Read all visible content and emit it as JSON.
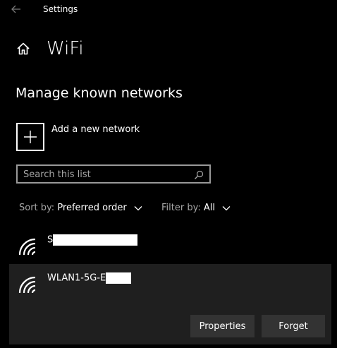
{
  "titlebar": {
    "title": "Settings"
  },
  "page": {
    "title": "WiFi"
  },
  "section": {
    "title": "Manage known networks"
  },
  "add_network": {
    "label": "Add a new network"
  },
  "search": {
    "placeholder": "Search this list"
  },
  "sort": {
    "label": "Sort by:",
    "value": "Preferred order"
  },
  "filter": {
    "label": "Filter by:",
    "value": "All"
  },
  "networks": [
    {
      "name": "S"
    },
    {
      "name": "WLAN1-5G-E"
    }
  ],
  "actions": {
    "properties_label": "Properties",
    "forget_label": "Forget"
  },
  "colors": {
    "background": "#000000",
    "selected_row": "#1f1f1f",
    "button": "#333333",
    "secondary_text": "#a6a6a6"
  },
  "icons": {
    "back": "arrow-left-icon",
    "home": "home-icon",
    "add": "plus-icon",
    "search": "search-icon",
    "network": "wifi-icon",
    "dropdown": "chevron-down-icon"
  }
}
